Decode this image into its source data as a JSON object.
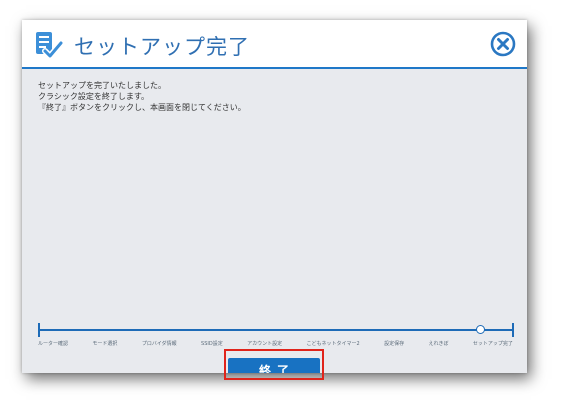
{
  "dialog": {
    "title": "セットアップ完了",
    "title_icon": "checklist-icon",
    "close_icon": "close-circle-icon",
    "accent_color": "#1f78c8",
    "message_lines": [
      "セットアップを完了いたしました。",
      "クラシック設定を終了します。",
      "『終了』ボタンをクリックし、本画面を閉じてください。"
    ],
    "steps": [
      "ルーター確認",
      "モード選択",
      "プロバイダ情報",
      "SSID設定",
      "アカウント設定",
      "こどもネットタイマー2",
      "設定保存",
      "えれきぼ",
      "セットアップ完了"
    ],
    "current_step": "セットアップ完了",
    "finish_button_label": "終了",
    "highlight_color": "#e0241b"
  }
}
